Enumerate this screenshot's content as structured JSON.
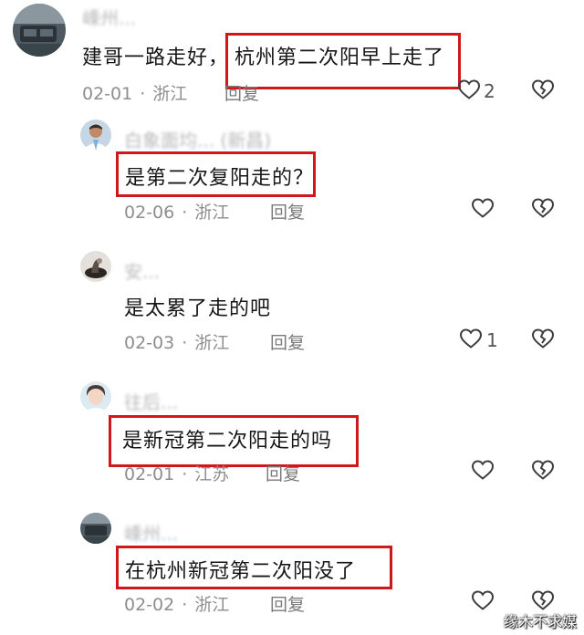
{
  "comments": [
    {
      "username": "嵊州...",
      "text_prefix": "建哥一路走好，",
      "text_highlight": "杭州第二次阳早上走了",
      "date": "02-01",
      "region": "浙江",
      "reply": "回复",
      "likes": "2"
    },
    {
      "username": "白象面均... (新昌)",
      "text_highlight": "是第二次复阳走的？",
      "date": "02-06",
      "region": "浙江",
      "reply": "回复",
      "likes": ""
    },
    {
      "username": "安...",
      "text": "是太累了走的吧",
      "date": "02-03",
      "region": "浙江",
      "reply": "回复",
      "likes": "1"
    },
    {
      "username": "往后...",
      "text_highlight": "是新冠第二次阳走的吗",
      "date": "02-01",
      "region": "江苏",
      "reply": "回复",
      "likes": ""
    },
    {
      "username": "嵊州...",
      "text_highlight": "在杭州新冠第二次阳没了",
      "date": "02-02",
      "region": "浙江",
      "reply": "回复",
      "likes": ""
    }
  ],
  "separator": "·",
  "watermark": "缘木不求媒",
  "colors": {
    "highlight_border": "#d0171c",
    "meta": "#8e8e8e",
    "text": "#161616"
  },
  "icons": {
    "like": "heart-outline-icon",
    "dislike": "broken-heart-icon"
  }
}
